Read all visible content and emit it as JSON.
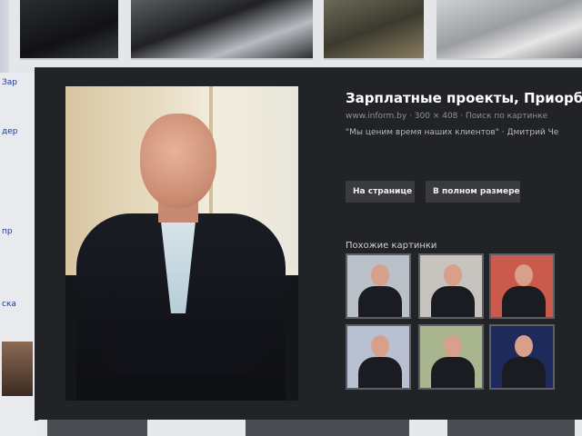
{
  "preview": {
    "title": "Зарплатные проекты, Приорб",
    "meta": "www.inform.by · 300 × 408 · Поиск по картинке",
    "quote": "\"Мы ценим время наших клиентов\" · Дмитрий Че",
    "buttons": {
      "open_page": "На странице",
      "full_size": "В полном размере"
    },
    "similar_label": "Похожие картинки",
    "similar_images": [
      {
        "bg": "#b9c0c7"
      },
      {
        "bg": "#c7c3bf"
      },
      {
        "bg": "#c95a4c"
      },
      {
        "bg": "#b8c0d2"
      },
      {
        "bg": "#a8b58f"
      },
      {
        "bg": "#1e2b5a"
      }
    ]
  },
  "sidebar": {
    "fragments": [
      "Зар",
      "дер",
      "пр",
      "ска"
    ]
  },
  "colors": {
    "panel": "#222327",
    "button": "#383a40",
    "title": "#ffffff"
  }
}
